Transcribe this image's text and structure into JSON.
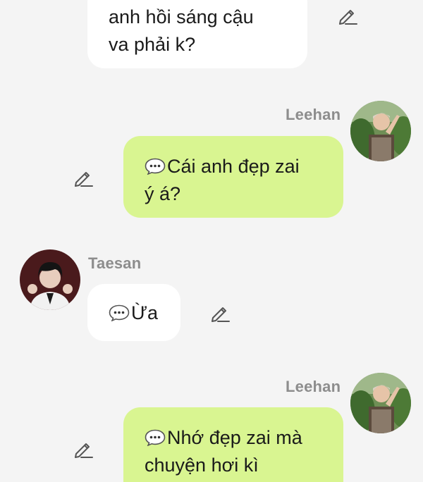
{
  "messages": [
    {
      "side": "left",
      "lines": [
        "anh hồi sáng cậu",
        "va phải k?"
      ]
    },
    {
      "side": "right",
      "sender": "Leehan",
      "lines": [
        "Cái anh đẹp zai",
        "ý á?"
      ]
    },
    {
      "side": "left",
      "sender": "Taesan",
      "lines": [
        "Ừa"
      ]
    },
    {
      "side": "right",
      "sender": "Leehan",
      "lines": [
        "Nhớ đẹp zai mà",
        "chuyện hơi kì"
      ]
    }
  ],
  "icons": {
    "edit": "pencil-edit-icon",
    "chat_glyph": "speech-bubble-ellipsis-icon"
  },
  "colors": {
    "background": "#f4f4f4",
    "incoming_bubble": "#ffffff",
    "outgoing_bubble": "#d9f591",
    "sender_name": "#8d8d8d",
    "text": "#1a1a1a"
  }
}
